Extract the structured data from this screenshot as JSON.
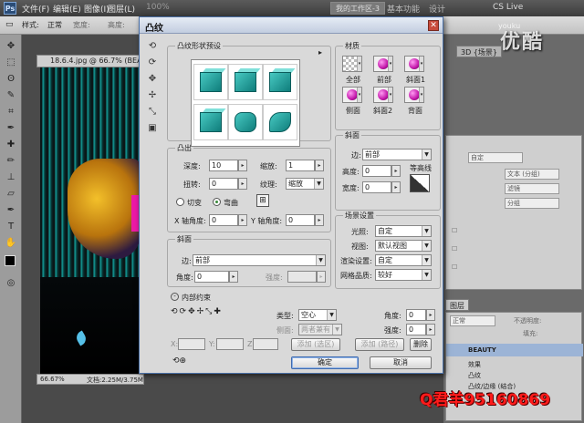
{
  "app": {
    "logo": "Ps",
    "menu": [
      "文件(F)",
      "编辑(E)",
      "图像(I)",
      "图层(L)"
    ],
    "zoom_select": "100%",
    "workspace_active": "我的工作区-3",
    "workspace_items": [
      "基本功能",
      "设计"
    ],
    "cslive": "CS Live"
  },
  "watermark": {
    "brand": "优酷",
    "site": "youku"
  },
  "options_bar": {
    "items": [
      "样式:",
      "正常",
      "宽度:",
      "高度:"
    ]
  },
  "document": {
    "tab_title": "18.6.4.jpg @ 66.7% (BEAU",
    "zoom": "66.67%",
    "doc_size": "文档:2.25M/3.75M"
  },
  "right_panel": {
    "tab_3d": "3D {场景}",
    "adjust_labels": [
      "自定",
      "文本 (分组)",
      "滤镜",
      "分组"
    ],
    "layers_tab": "图层",
    "blend_mode": "正常",
    "opacity_label": "不透明度:",
    "fill_label": "填充:",
    "layer_name": "BEAUTY",
    "layer_sub": [
      "效果",
      "凸纹",
      "凸纹/边缘 (结合)"
    ]
  },
  "contact": "Q君羊95160869",
  "dialog": {
    "title": "凸纹",
    "preset_group": "凸纹形状预设",
    "extrude": {
      "legend": "凸出",
      "depth_label": "深度:",
      "depth": "10",
      "scale_label": "缩放:",
      "scale": "1",
      "twist_label": "扭转:",
      "twist": "0",
      "texture_label": "纹理:",
      "texture": "缩放",
      "bevel_radio": "切变",
      "bend_radio": "弯曲",
      "xangle_label": "X 轴角度:",
      "xangle": "0",
      "yangle_label": "Y 轴角度:",
      "yangle": "0"
    },
    "bevel": {
      "legend": "斜面",
      "edge_label": "边:",
      "edge": "前部",
      "angle_label": "角度:",
      "angle": "0",
      "strength_label": "强度:"
    },
    "inner": {
      "legend": "内部约束",
      "type_label": "类型:",
      "type": "空心",
      "side_label": "侧面:",
      "side": "两者兼有",
      "angle_label": "角度:",
      "angle": "0",
      "strength_label": "强度:",
      "strength": "0",
      "add_dup": "添加 (选区)",
      "add_path": "添加 (路径)",
      "delete": "删除",
      "x_label": "X:",
      "y_label": "Y:",
      "z_label": "Z:"
    },
    "materials": {
      "legend": "材质",
      "labels": [
        "全部",
        "前部",
        "斜面1",
        "侧面",
        "斜面2",
        "背面"
      ]
    },
    "bevel_right": {
      "legend": "斜面",
      "edge_label": "边:",
      "edge": "前部",
      "height_label": "高度:",
      "height": "0",
      "width_label": "宽度:",
      "width": "0",
      "contour_label": "等高线"
    },
    "scene": {
      "legend": "场景设置",
      "lights_label": "光照:",
      "lights": "自定",
      "view_label": "视图:",
      "view": "默认视图",
      "render_label": "渲染设置:",
      "render": "自定",
      "mesh_label": "网格品质:",
      "mesh": "较好"
    },
    "ok": "确定",
    "cancel": "取消"
  }
}
